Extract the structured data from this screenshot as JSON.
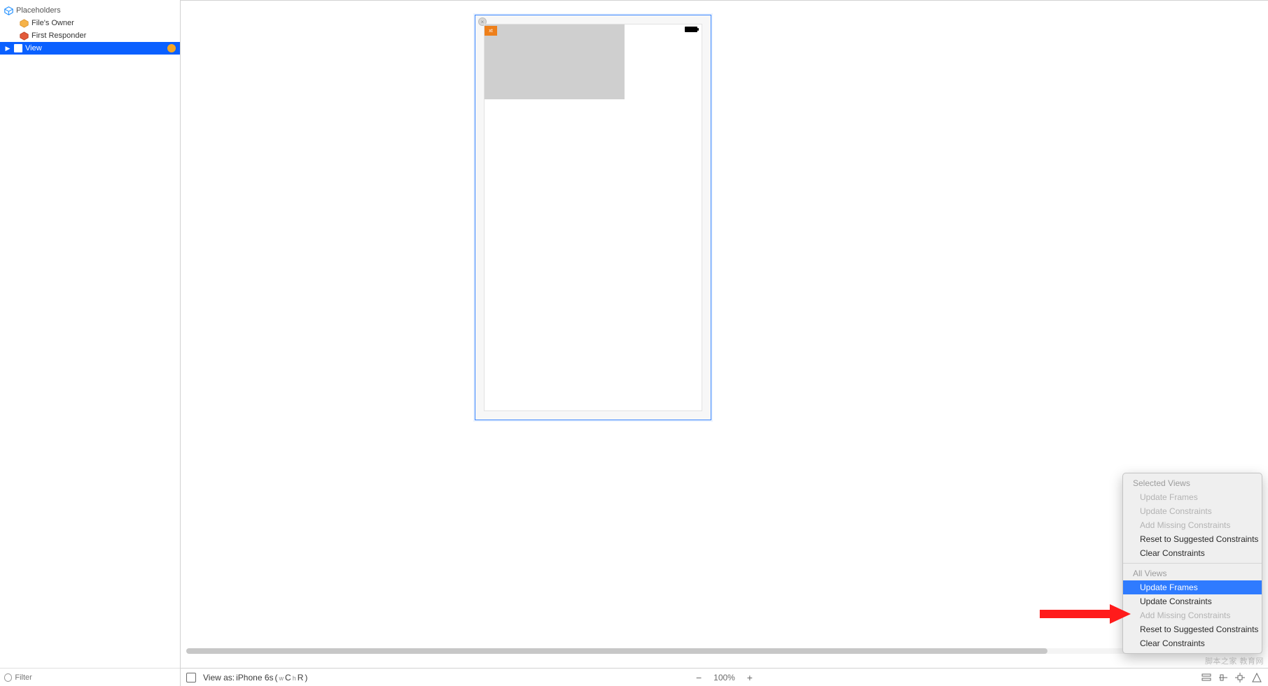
{
  "sidebar": {
    "placeholders_label": "Placeholders",
    "files_owner": "File's Owner",
    "first_responder": "First Responder",
    "view_label": "View",
    "filter_placeholder": "Filter"
  },
  "canvas": {
    "orange_tag_text": "xt"
  },
  "bottom_bar": {
    "view_as_prefix": "View as: ",
    "device": "iPhone 6s",
    "paren_open": " (",
    "w_sub": "w",
    "c_label": "C ",
    "h_sub": "h",
    "r_label": "R",
    "paren_close": ")",
    "zoom_label": "100%"
  },
  "context_menu": {
    "section1_header": "Selected Views",
    "s1_items": [
      "Update Frames",
      "Update Constraints",
      "Add Missing Constraints",
      "Reset to Suggested Constraints",
      "Clear Constraints"
    ],
    "section2_header": "All Views",
    "s2_items": [
      "Update Frames",
      "Update Constraints",
      "Add Missing Constraints",
      "Reset to Suggested Constraints",
      "Clear Constraints"
    ]
  },
  "watermark": "脚本之家 教育网"
}
